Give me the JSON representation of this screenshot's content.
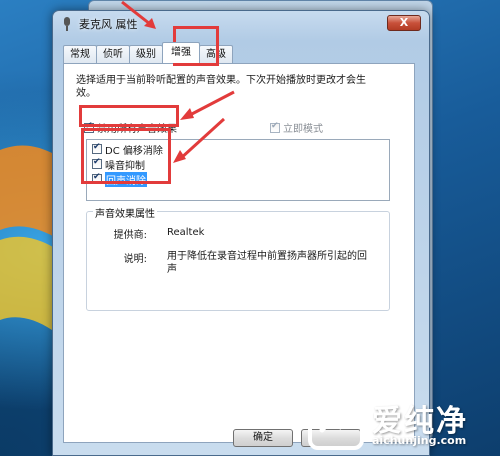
{
  "window": {
    "title": "麦克风 属性",
    "close_label": "X"
  },
  "tabs": [
    {
      "label": "常规"
    },
    {
      "label": "侦听"
    },
    {
      "label": "级别"
    },
    {
      "label": "增强"
    },
    {
      "label": "高级"
    }
  ],
  "enhancements": {
    "description": "选择适用于当前聆听配置的声音效果。下次开始播放时更改才会生效。",
    "disable_all_label": "禁用所有声音效果",
    "disable_all_checked": true,
    "immediate_mode_label": "立即模式",
    "immediate_mode_checked": true,
    "immediate_mode_enabled": false,
    "effects": [
      {
        "label": "DC 偏移消除",
        "checked": true,
        "selected": false
      },
      {
        "label": "噪音抑制",
        "checked": true,
        "selected": false
      },
      {
        "label": "回声消除",
        "checked": true,
        "selected": true
      }
    ]
  },
  "properties": {
    "title": "声音效果属性",
    "provider_key": "提供商:",
    "provider_value": "Realtek",
    "description_key": "说明:",
    "description_value": "用于降低在录音过程中前置扬声器所引起的回声"
  },
  "buttons": {
    "ok": "确定"
  },
  "watermark": {
    "title": "爱纯净",
    "url": "aichunjing.com"
  },
  "colors": {
    "highlight": "#e23b3b",
    "selection": "#3399ff"
  }
}
